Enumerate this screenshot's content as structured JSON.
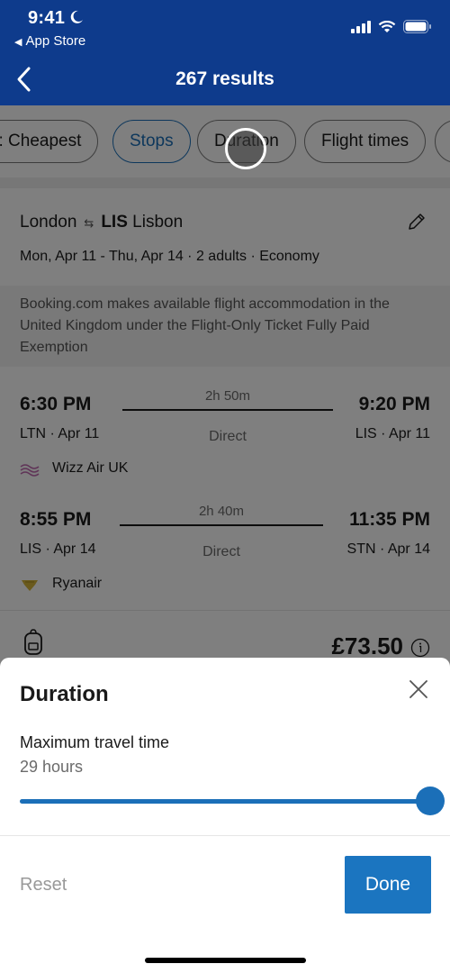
{
  "status_bar": {
    "time": "9:41",
    "back_app": "App Store",
    "icons": [
      "moon-icon",
      "signal-icon",
      "wifi-icon",
      "battery-icon"
    ]
  },
  "nav": {
    "title": "267 results",
    "back_icon": "chevron-left-icon"
  },
  "filters": {
    "chips": [
      {
        "label": "Sort by: Cheapest",
        "visible_label": "y: Cheapest",
        "active": false
      },
      {
        "label": "Stops",
        "active": true
      },
      {
        "label": "Duration",
        "active": false
      },
      {
        "label": "Flight times",
        "active": false
      }
    ]
  },
  "search": {
    "origin": "London",
    "destination_code": "LIS",
    "destination": "Lisbon",
    "swap_icon": "swap-arrows-icon",
    "details": "Mon, Apr 11 - Thu, Apr 14 · 2 adults · Economy",
    "edit_icon": "pencil-icon"
  },
  "disclaimer": "Booking.com makes available flight accommodation in the United Kingdom under the Flight-Only Ticket Fully Paid Exemption",
  "result": {
    "legs": [
      {
        "dep_time": "6:30 PM",
        "dep_sub": "LTN · Apr 11",
        "duration": "2h 50m",
        "stops": "Direct",
        "arr_time": "9:20 PM",
        "arr_sub": "LIS · Apr 11",
        "airline": "Wizz Air UK"
      },
      {
        "dep_time": "8:55 PM",
        "dep_sub": "LIS · Apr 14",
        "duration": "2h 40m",
        "stops": "Direct",
        "arr_time": "11:35 PM",
        "arr_sub": "STN · Apr 14",
        "airline": "Ryanair"
      }
    ],
    "price": "£73.50"
  },
  "sheet": {
    "title": "Duration",
    "slider_label": "Maximum travel time",
    "slider_value": "29 hours",
    "slider_fraction": 1.0,
    "reset_label": "Reset",
    "done_label": "Done"
  },
  "colors": {
    "header_blue": "#0e3b8c",
    "accent_blue": "#1b6fb8",
    "done_blue": "#1b75c0"
  }
}
